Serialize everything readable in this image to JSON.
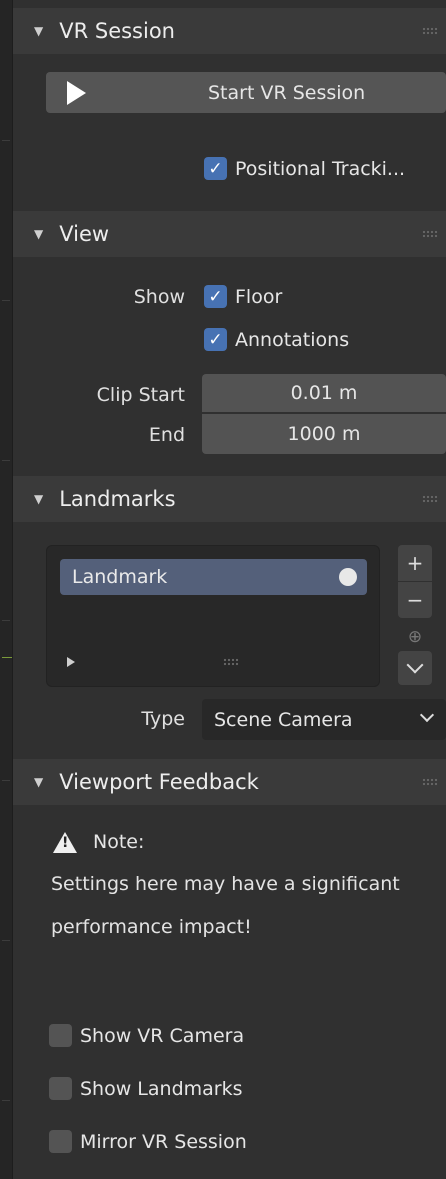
{
  "vr_session": {
    "title": "VR Session",
    "start_button": "Start VR Session",
    "positional_tracking": {
      "label": "Positional Tracki...",
      "checked": true
    }
  },
  "view": {
    "title": "View",
    "show_label": "Show",
    "floor": {
      "label": "Floor",
      "checked": true
    },
    "annotations": {
      "label": "Annotations",
      "checked": true
    },
    "clip_start_label": "Clip Start",
    "clip_start_value": "0.01 m",
    "clip_end_label": "End",
    "clip_end_value": "1000 m"
  },
  "landmarks": {
    "title": "Landmarks",
    "items": [
      {
        "label": "Landmark"
      }
    ],
    "type_label": "Type",
    "type_value": "Scene Camera"
  },
  "viewport_feedback": {
    "title": "Viewport Feedback",
    "note_label": "Note:",
    "note_text_line1": "Settings here may have a significant",
    "note_text_line2": "performance impact!",
    "options": [
      {
        "label": "Show VR Camera",
        "checked": false
      },
      {
        "label": "Show Landmarks",
        "checked": false
      },
      {
        "label": "Mirror VR Session",
        "checked": false
      }
    ]
  },
  "colors": {
    "checkbox_on": "#4772b3",
    "selected_item": "#54607a",
    "panel_header": "#3a3a3a",
    "panel_bg": "#303030"
  },
  "icons": [
    "play-icon",
    "checkmark-icon",
    "collapse-arrow-icon",
    "drag-handle-icon",
    "plus-icon",
    "minus-icon",
    "add-circle-icon",
    "chevron-down-icon",
    "warning-icon",
    "radio-dot-icon"
  ]
}
